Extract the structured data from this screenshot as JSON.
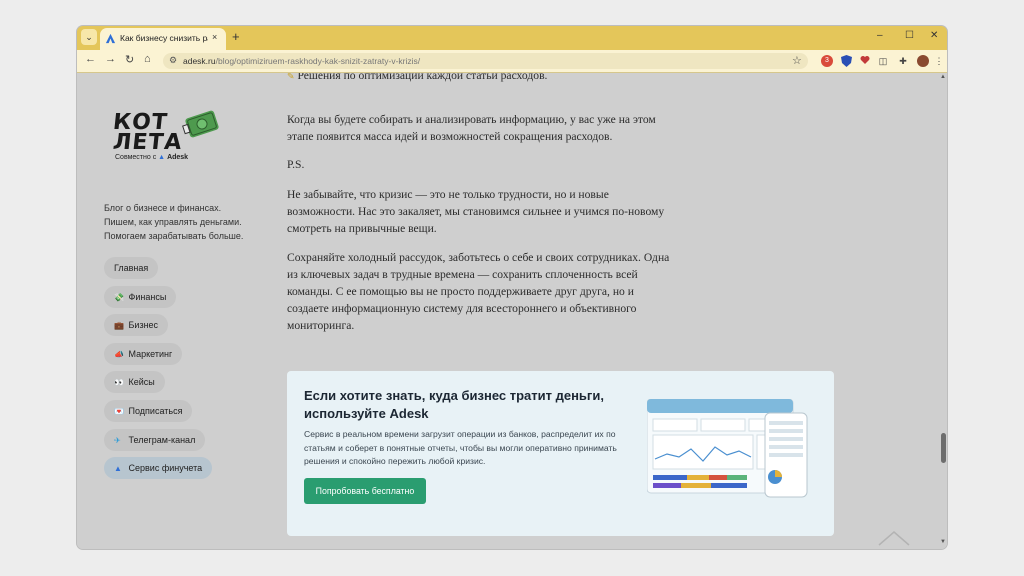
{
  "browser": {
    "tab_title": "Как бизнесу снизить расходы",
    "tab_close": "×",
    "new_tab": "+",
    "tab_menu": "⌄",
    "window_controls": {
      "minimize": "–",
      "maximize": "☐",
      "close": "✕"
    },
    "nav": {
      "back": "←",
      "forward": "→",
      "reload": "↻",
      "home": "⌂"
    },
    "url_host": "adesk.ru",
    "url_path": "/blog/optimiziruem-raskhody-kak-snizit-zatraty-v-krizis/",
    "extension_badge": "3",
    "accent_color": "#e4c65a"
  },
  "sidebar": {
    "logo_line1": "КОТ",
    "logo_line2": "ЛЕТА",
    "logo_sub": "Совместно с",
    "logo_brand": "Adesk",
    "tagline": [
      "Блог о бизнесе и финансах.",
      "Пишем, как управлять деньгами.",
      "Помогаем зарабатывать больше."
    ],
    "items": [
      {
        "label": "Главная",
        "icon": ""
      },
      {
        "label": "Финансы",
        "icon": "💸"
      },
      {
        "label": "Бизнес",
        "icon": "💼"
      },
      {
        "label": "Маркетинг",
        "icon": "📣"
      },
      {
        "label": "Кейсы",
        "icon": "👀"
      },
      {
        "label": "Подписаться",
        "icon": "💌"
      },
      {
        "label": "Телеграм-канал",
        "icon": "✈"
      },
      {
        "label": "Сервис финучета",
        "icon": "▲"
      }
    ]
  },
  "article": {
    "bullet": "Решения по оптимизации каждой статьи расходов.",
    "p1": "Когда вы будете собирать и анализировать информацию, у вас уже на этом этапе появится масса идей и возможностей сокращения расходов.",
    "ps": "P.S.",
    "p2": "Не забывайте, что кризис — это не только трудности, но и новые возможности. Нас это закаляет, мы становимся сильнее и учимся по-новому смотреть на привычные вещи.",
    "p3": "Сохраняйте холодный рассудок, заботьтесь о себе и своих сотрудниках. Одна из ключевых задач в трудные времена — сохранить сплоченность всей команды. С ее помощью вы не просто поддерживаете друг друга, но и создаете информационную систему для всестороннего и объективного мониторинга."
  },
  "promo": {
    "title": "Если хотите знать, куда бизнес тратит деньги, используйте Adesk",
    "text": "Сервис в реальном времени загрузит операции из банков, распределит их по статьям и соберет в понятные отчеты, чтобы вы могли оперативно принимать решения и спокойно пережить любой кризис.",
    "button": "Попробовать бесплатно",
    "button_color": "#2a9d70"
  }
}
